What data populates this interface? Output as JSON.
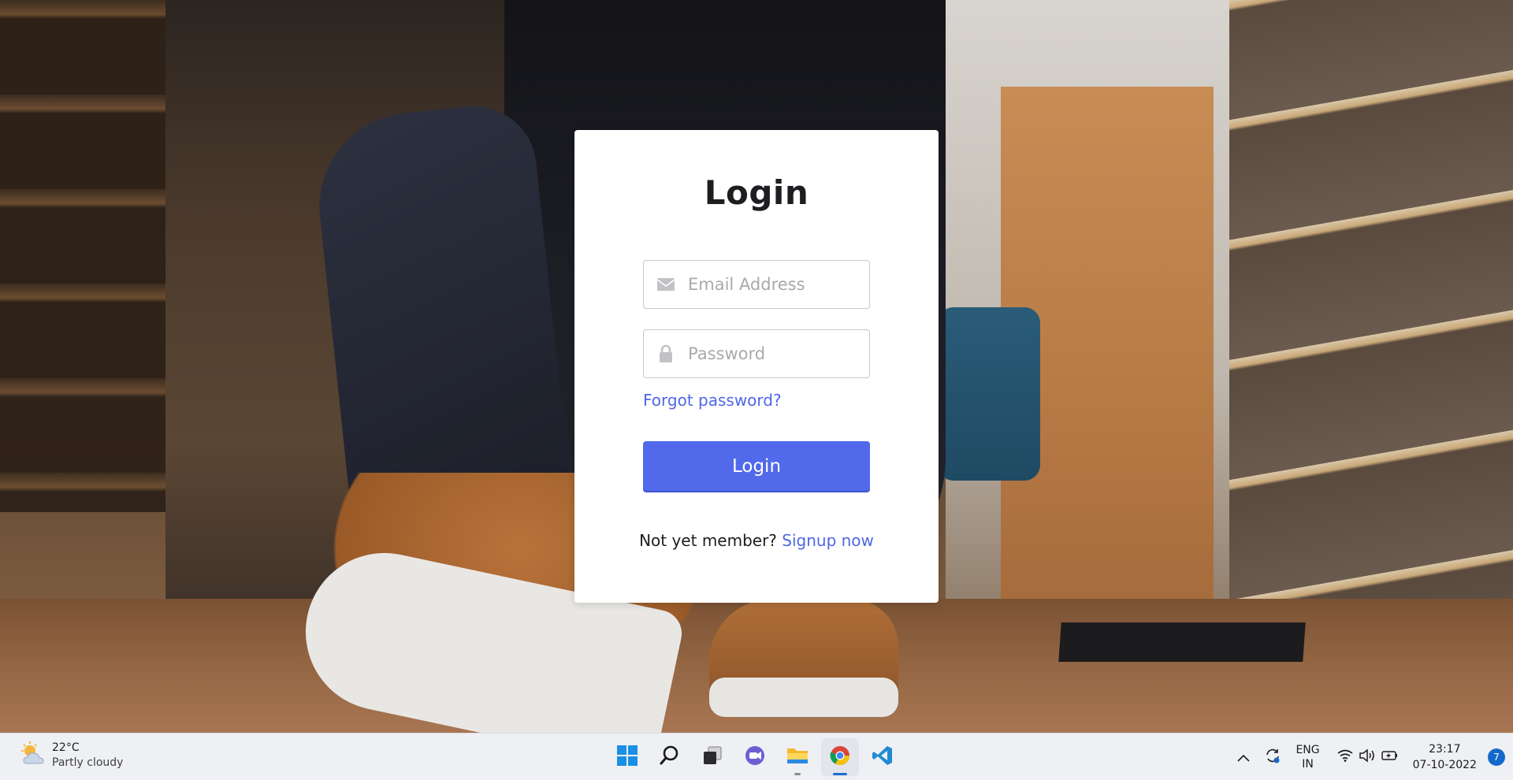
{
  "login": {
    "title": "Login",
    "email_placeholder": "Email Address",
    "password_placeholder": "Password",
    "forgot_link": "Forgot password?",
    "submit_label": "Login",
    "signup_prompt": "Not yet member?",
    "signup_link": "Signup now"
  },
  "taskbar": {
    "weather": {
      "temp": "22°C",
      "desc": "Partly cloudy"
    },
    "apps": [
      "start-icon",
      "search-icon",
      "task-view-icon",
      "teams-chat-icon",
      "file-explorer-icon",
      "chrome-icon",
      "vscode-icon"
    ],
    "active_app": "chrome-icon",
    "language": {
      "line1": "ENG",
      "line2": "IN"
    },
    "clock": {
      "time": "23:17",
      "date": "07-10-2022"
    },
    "notification_count": "7"
  },
  "colors": {
    "accent": "#5169ea",
    "link": "#4f67e8",
    "card_bg": "#ffffff",
    "taskbar_bg": "#eef0f4"
  }
}
